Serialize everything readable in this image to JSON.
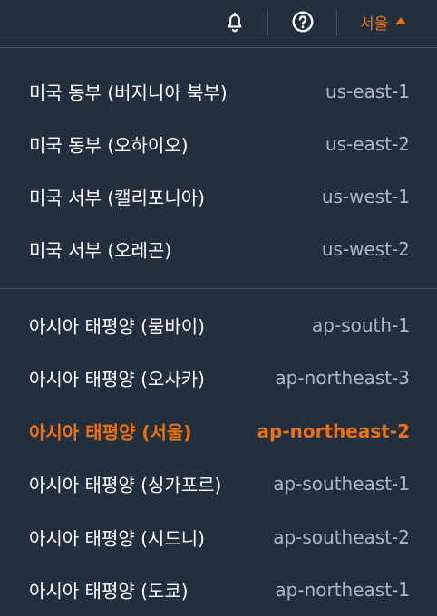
{
  "header": {
    "current_region": "서울",
    "icons": {
      "notifications": "bell-icon",
      "help": "help-circle-icon",
      "region_caret": "caret-up-icon"
    }
  },
  "colors": {
    "background": "#232f3e",
    "accent": "#ec7211",
    "text": "#ffffff",
    "muted": "#aab7c4",
    "divider": "#414d5c"
  },
  "regions": {
    "group1": [
      {
        "name": "미국 동부 (버지니아 북부)",
        "code": "us-east-1"
      },
      {
        "name": "미국 동부 (오하이오)",
        "code": "us-east-2"
      },
      {
        "name": "미국 서부 (캘리포니아)",
        "code": "us-west-1"
      },
      {
        "name": "미국 서부 (오레곤)",
        "code": "us-west-2"
      }
    ],
    "group2": [
      {
        "name": "아시아 태평양 (뭄바이)",
        "code": "ap-south-1"
      },
      {
        "name": "아시아 태평양 (오사카)",
        "code": "ap-northeast-3"
      },
      {
        "name": "아시아 태평양 (서울)",
        "code": "ap-northeast-2",
        "selected": true
      },
      {
        "name": "아시아 태평양 (싱가포르)",
        "code": "ap-southeast-1"
      },
      {
        "name": "아시아 태평양 (시드니)",
        "code": "ap-southeast-2"
      },
      {
        "name": "아시아 태평양 (도쿄)",
        "code": "ap-northeast-1"
      }
    ]
  }
}
